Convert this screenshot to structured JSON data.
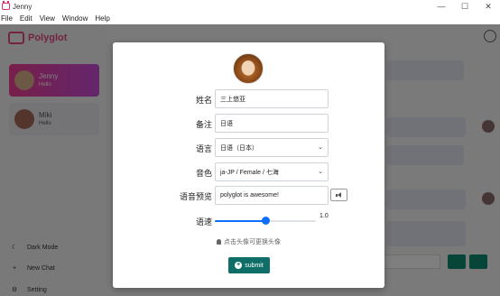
{
  "window": {
    "title": "Jenny",
    "minimize": "—",
    "maximize": "☐",
    "close": "✕"
  },
  "menu": [
    "File",
    "Edit",
    "View",
    "Window",
    "Help"
  ],
  "background": {
    "brand": "Polyglot",
    "contacts": [
      {
        "name": "Jenny",
        "sub": "Hello"
      },
      {
        "name": "Miki",
        "sub": "Hello"
      }
    ],
    "actions": [
      "Dark Mode",
      "New Chat",
      "Setting"
    ]
  },
  "modal": {
    "name_label": "姓名",
    "name_value": "三上悠亚",
    "note_label": "备注",
    "note_value": "日语",
    "language_label": "语言",
    "language_value": "日语（日本）",
    "voice_label": "音色",
    "voice_value": "ja-JP / Female / 七海",
    "preview_label": "语音预览",
    "preview_value": "polyglot is awesome!",
    "speed_label": "语速",
    "speed_value": "1.0",
    "speed_fraction": 0.5,
    "hint": "点击头像可更换头像",
    "submit": "submit"
  },
  "colors": {
    "accent": "#0f6f68",
    "slider": "#0d6efd",
    "brand": "#e64980"
  }
}
